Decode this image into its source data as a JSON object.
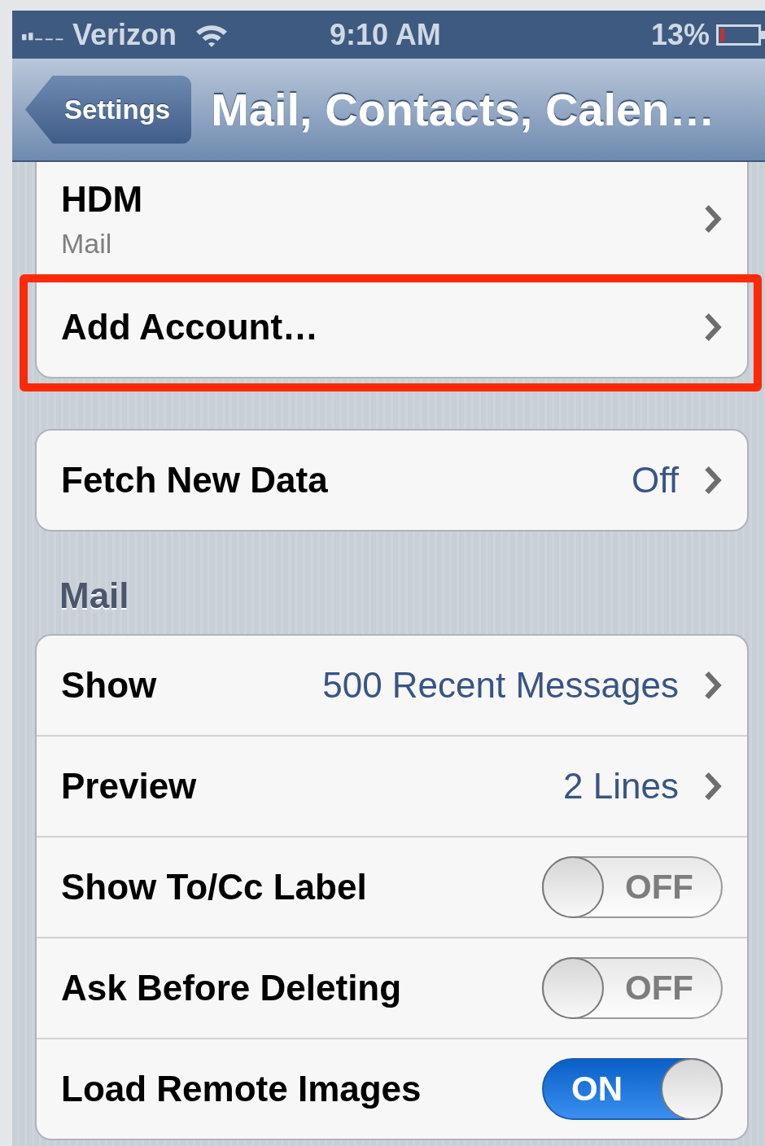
{
  "status_bar": {
    "carrier": "Verizon",
    "time": "9:10 AM",
    "battery": "13%"
  },
  "nav_bar": {
    "back": "Settings",
    "title": "Mail, Contacts, Calen…"
  },
  "groups": [
    {
      "rows": [
        {
          "kind": "account",
          "label": "HDM",
          "subtitle": "Mail",
          "highlighted": false
        },
        {
          "kind": "link",
          "label": "Add Account…",
          "highlighted": true
        }
      ]
    },
    {
      "rows": [
        {
          "kind": "link",
          "label": "Fetch New Data",
          "value": "Off",
          "highlighted": false
        }
      ]
    },
    {
      "header": "Mail",
      "rows": [
        {
          "kind": "link",
          "label": "Show",
          "value": "500 Recent Messages",
          "highlighted": false
        },
        {
          "kind": "link",
          "label": "Preview",
          "value": "2 Lines",
          "highlighted": false
        },
        {
          "kind": "toggle",
          "label": "Show To/Cc Label",
          "on": false,
          "toggle_text": "OFF",
          "highlighted": false
        },
        {
          "kind": "toggle",
          "label": "Ask Before Deleting",
          "on": false,
          "toggle_text": "OFF",
          "highlighted": false
        },
        {
          "kind": "toggle",
          "label": "Load Remote Images",
          "on": true,
          "toggle_text": "ON",
          "highlighted": false
        }
      ]
    }
  ]
}
